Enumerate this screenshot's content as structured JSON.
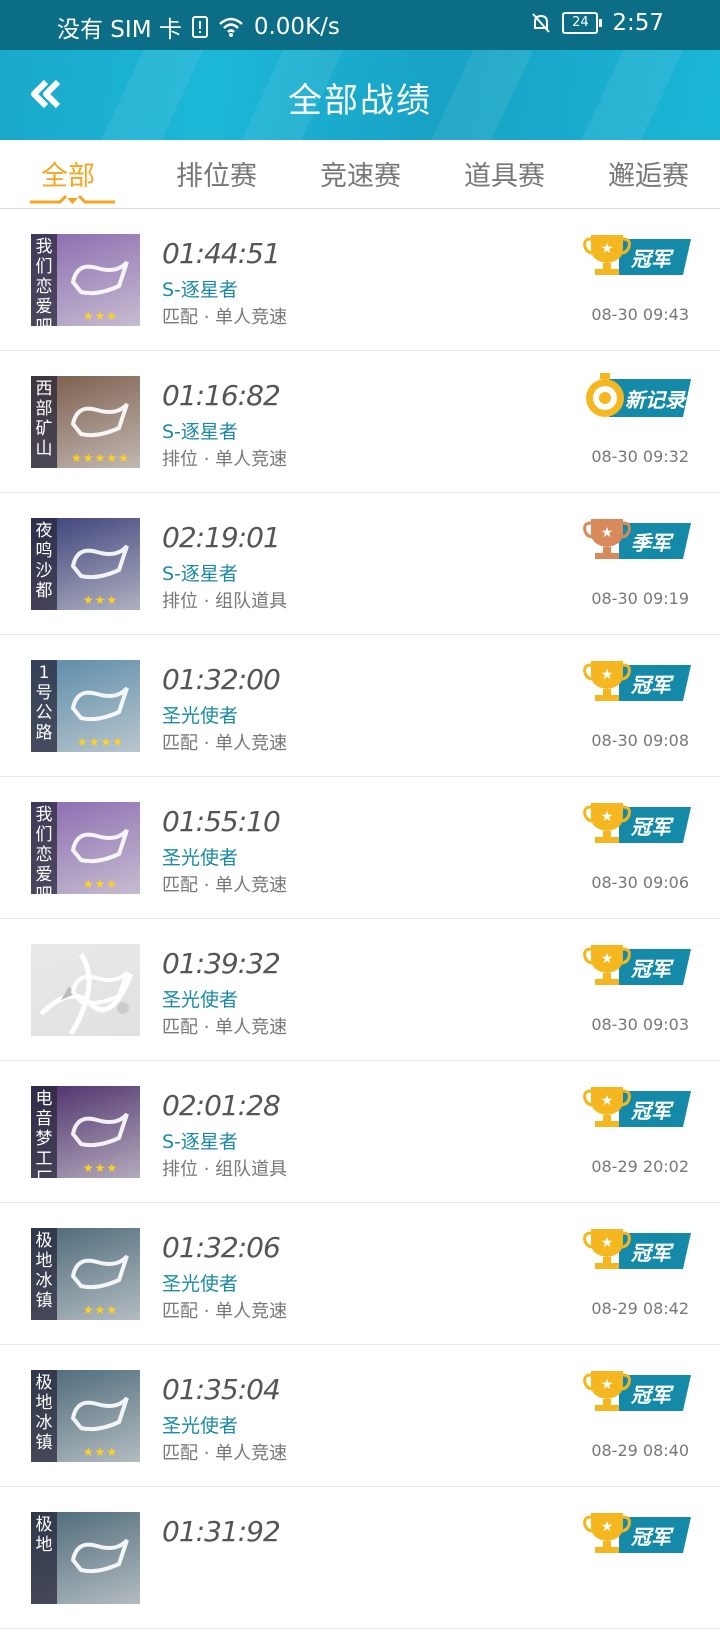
{
  "status": {
    "carrier": "没有 SIM 卡",
    "speed": "0.00K/s",
    "battery": "24",
    "time": "2:57"
  },
  "header": {
    "title": "全部战绩"
  },
  "tabs": [
    {
      "label": "全部"
    },
    {
      "label": "排位赛"
    },
    {
      "label": "竞速赛"
    },
    {
      "label": "道具赛"
    },
    {
      "label": "邂逅赛"
    }
  ],
  "records": [
    {
      "map": "我们恋爱吧",
      "stars": "★★★",
      "time": "01:44:51",
      "car": "S-逐星者",
      "mode": "匹配 · 单人竞速",
      "date": "08-30 09:43",
      "badge": "冠军",
      "thumb_color": "#8a6ab0"
    },
    {
      "map": "西部矿山",
      "stars": "★★★★★",
      "time": "01:16:82",
      "car": "S-逐星者",
      "mode": "排位 · 单人竞速",
      "date": "08-30 09:32",
      "badge": "新记录",
      "thumb_color": "#7a5a48"
    },
    {
      "map": "夜鸣沙都",
      "stars": "★★★",
      "time": "02:19:01",
      "car": "S-逐星者",
      "mode": "排位 · 组队道具",
      "date": "08-30 09:19",
      "badge": "季军",
      "thumb_color": "#3a3f78"
    },
    {
      "map": "1号公路",
      "stars": "★★★★",
      "time": "01:32:00",
      "car": "圣光使者",
      "mode": "匹配 · 单人竞速",
      "date": "08-30 09:08",
      "badge": "冠军",
      "thumb_color": "#5a8aa8"
    },
    {
      "map": "我们恋爱吧",
      "stars": "★★★",
      "time": "01:55:10",
      "car": "圣光使者",
      "mode": "匹配 · 单人竞速",
      "date": "08-30 09:06",
      "badge": "冠军",
      "thumb_color": "#8a6ab0"
    },
    {
      "map": "",
      "stars": "",
      "time": "01:39:32",
      "car": "圣光使者",
      "mode": "匹配 · 单人竞速",
      "date": "08-30 09:03",
      "badge": "冠军",
      "thumb_color": "#e9e9e9"
    },
    {
      "map": "电音梦工厂",
      "stars": "★★★",
      "time": "02:01:28",
      "car": "S-逐星者",
      "mode": "排位 · 组队道具",
      "date": "08-29 20:02",
      "badge": "冠军",
      "thumb_color": "#4a2d6a"
    },
    {
      "map": "极地冰镇",
      "stars": "★★★",
      "time": "01:32:06",
      "car": "圣光使者",
      "mode": "匹配 · 单人竞速",
      "date": "08-29 08:42",
      "badge": "冠军",
      "thumb_color": "#4a6878"
    },
    {
      "map": "极地冰镇",
      "stars": "★★★",
      "time": "01:35:04",
      "car": "圣光使者",
      "mode": "匹配 · 单人竞速",
      "date": "08-29 08:40",
      "badge": "冠军",
      "thumb_color": "#4a6878"
    },
    {
      "map": "极地",
      "stars": "",
      "time": "01:31:92",
      "car": "",
      "mode": "",
      "date": "",
      "badge": "冠军",
      "thumb_color": "#4a6878"
    }
  ],
  "colors": {
    "accent": "#f5a524",
    "header": "#1aa9c9",
    "car_text": "#1c8aa6",
    "gold": "#f5b720",
    "bronze": "#d88a5a",
    "teal_banner": "#148aa8"
  }
}
